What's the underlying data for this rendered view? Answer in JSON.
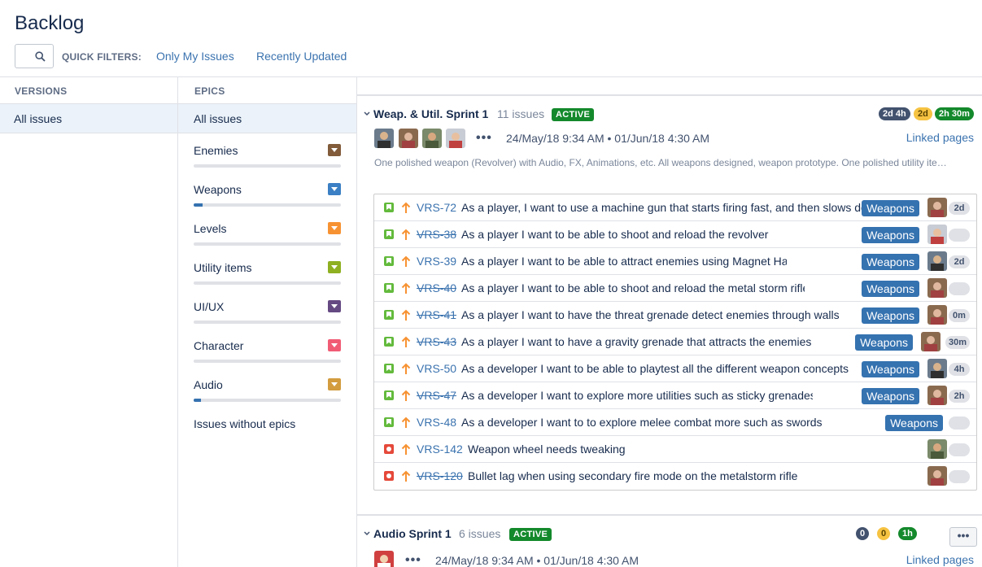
{
  "page": {
    "title": "Backlog"
  },
  "quick_filters": {
    "label": "QUICK FILTERS:",
    "items": [
      "Only My Issues",
      "Recently Updated"
    ]
  },
  "versions": {
    "heading": "VERSIONS",
    "all_label": "All issues"
  },
  "epics": {
    "heading": "EPICS",
    "all_label": "All issues",
    "items": [
      {
        "name": "Enemies",
        "color": "#815b3a",
        "progress": 0
      },
      {
        "name": "Weapons",
        "color": "#3b7fc4",
        "progress": 0.06
      },
      {
        "name": "Levels",
        "color": "#f79232",
        "progress": 0
      },
      {
        "name": "Utility items",
        "color": "#8eb021",
        "progress": 0
      },
      {
        "name": "UI/UX",
        "color": "#654982",
        "progress": 0
      },
      {
        "name": "Character",
        "color": "#f15c75",
        "progress": 0
      },
      {
        "name": "Audio",
        "color": "#d39c3f",
        "progress": 0.05
      }
    ],
    "no_epics_label": "Issues without epics"
  },
  "sprint1": {
    "name": "Weap. & Util. Sprint 1",
    "count": "11 issues",
    "status": "ACTIVE",
    "badges": [
      "2d 4h",
      "2d",
      "2h 30m"
    ],
    "linked": "Linked pages",
    "dates": "24/May/18 9:34 AM • 01/Jun/18 4:30 AM",
    "more": "•••",
    "goal": "One polished weapon (Revolver) with Audio, FX, Animations, etc. All weapons designed, weapon prototype. One polished utility item (Magnet Hands) with Audio, FX, Animations, etc.",
    "issues": [
      {
        "type": "story",
        "key": "VRS-72",
        "done": false,
        "summary": "As a player, I want to use a machine gun that starts firing fast, and then slows down",
        "epic": "Weapons",
        "estimate": "2d",
        "avatar": "a"
      },
      {
        "type": "story",
        "key": "VRS-38",
        "done": true,
        "summary": "As a player I want to be able to shoot and reload the revolver",
        "epic": "Weapons",
        "estimate": "",
        "avatar": "b"
      },
      {
        "type": "story",
        "key": "VRS-39",
        "done": false,
        "summary": "As a player I want to be able to attract enemies using Magnet Hands",
        "epic": "Weapons",
        "estimate": "2d",
        "avatar": "c"
      },
      {
        "type": "story",
        "key": "VRS-40",
        "done": true,
        "summary": "As a player I want to be able to shoot and reload the metal storm rifle",
        "epic": "Weapons",
        "estimate": "",
        "avatar": "a"
      },
      {
        "type": "story",
        "key": "VRS-41",
        "done": true,
        "summary": "As a player I want to have the threat grenade detect enemies through walls",
        "epic": "Weapons",
        "estimate": "0m",
        "avatar": "a"
      },
      {
        "type": "story",
        "key": "VRS-43",
        "done": true,
        "summary": "As a player I want to have a gravity grenade that attracts the enemies",
        "epic": "Weapons",
        "estimate": "30m",
        "avatar": "a"
      },
      {
        "type": "story",
        "key": "VRS-50",
        "done": false,
        "summary": "As a developer I want to be able to playtest all the different weapon concepts",
        "epic": "Weapons",
        "estimate": "4h",
        "avatar": "c"
      },
      {
        "type": "story",
        "key": "VRS-47",
        "done": true,
        "summary": "As a developer I want to explore more utilities such as sticky grenades",
        "epic": "Weapons",
        "estimate": "2h",
        "avatar": "a"
      },
      {
        "type": "story",
        "key": "VRS-48",
        "done": false,
        "summary": "As a developer I want to to explore melee combat more such as swords",
        "epic": "Weapons",
        "estimate": "",
        "avatar": ""
      },
      {
        "type": "bug",
        "key": "VRS-142",
        "done": false,
        "summary": "Weapon wheel needs tweaking",
        "epic": "",
        "estimate": "",
        "avatar": "d"
      },
      {
        "type": "bug",
        "key": "VRS-120",
        "done": true,
        "summary": "Bullet lag when using secondary fire mode on the metalstorm rifle",
        "epic": "",
        "estimate": "",
        "avatar": "a"
      }
    ]
  },
  "sprint2": {
    "name": "Audio Sprint 1",
    "count": "6 issues",
    "status": "ACTIVE",
    "badges": [
      "0",
      "0",
      "1h"
    ],
    "linked": "Linked pages",
    "dates": "24/May/18 9:34 AM • 01/Jun/18 4:30 AM",
    "more": "•••",
    "menu": "•••"
  },
  "icons": {
    "search": "search-icon",
    "chevron": "chevron-down-icon",
    "story": "story-icon",
    "bug": "bug-icon",
    "priority": "priority-high-icon",
    "epic_dropdown": "epic-dropdown-icon"
  },
  "colors": {
    "link": "#3b73af",
    "epic_label": "#3572b0",
    "active": "#14892c",
    "story": "#63ba3c",
    "bug": "#e5493a",
    "priority": "#f79232"
  }
}
